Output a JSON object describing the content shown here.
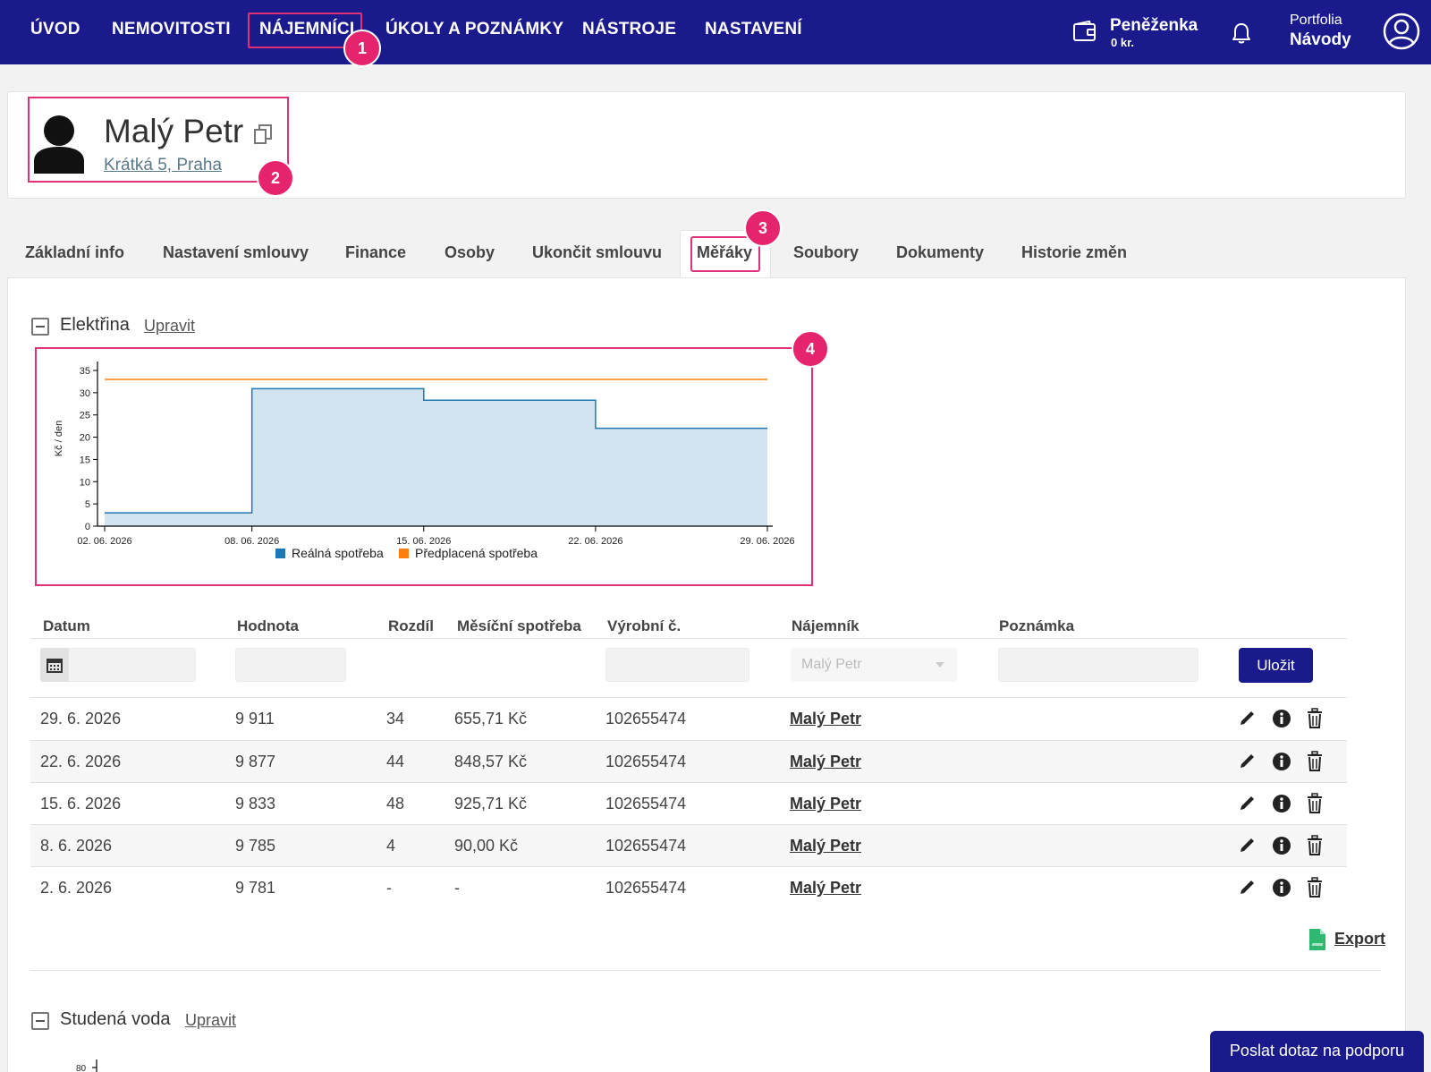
{
  "nav": {
    "items": [
      "ÚVOD",
      "NEMOVITOSTI",
      "NÁJEMNÍCI",
      "ÚKOLY A POZNÁMKY",
      "NÁSTROJE",
      "NASTAVENÍ"
    ],
    "wallet_title": "Peněženka",
    "wallet_value": "0 kr.",
    "portfolio_label": "Portfolia",
    "portfolio_value": "Návody"
  },
  "badges": [
    "1",
    "2",
    "3",
    "4"
  ],
  "tenant": {
    "name": "Malý Petr",
    "address": "Krátká 5, Praha"
  },
  "tabs": [
    "Základní info",
    "Nastavení smlouvy",
    "Finance",
    "Osoby",
    "Ukončit smlouvu",
    "Měřáky",
    "Soubory",
    "Dokumenty",
    "Historie změn"
  ],
  "active_tab": "Měřáky",
  "sections": [
    {
      "title": "Elektřina",
      "edit_label": "Upravit"
    },
    {
      "title": "Studená voda",
      "edit_label": "Upravit"
    }
  ],
  "chart_data": {
    "type": "area",
    "ylabel": "Kč / den",
    "ylim": [
      0,
      35
    ],
    "yticks": [
      "0",
      "5",
      "10",
      "15",
      "20",
      "25",
      "30",
      "35"
    ],
    "xticks": [
      "02. 06. 2026",
      "08. 06. 2026",
      "15. 06. 2026",
      "22. 06. 2026",
      "29. 06. 2026"
    ],
    "series": [
      {
        "name": "Reálná spotřeba",
        "color": "#1f77b4",
        "fill": "#d3e3f0",
        "steps": [
          {
            "from": "02. 06. 2026",
            "to": "08. 06. 2026",
            "value": 3.0
          },
          {
            "from": "08. 06. 2026",
            "to": "15. 06. 2026",
            "value": 30.9
          },
          {
            "from": "15. 06. 2026",
            "to": "22. 06. 2026",
            "value": 28.3
          },
          {
            "from": "22. 06. 2026",
            "to": "29. 06. 2026",
            "value": 22.0
          }
        ]
      },
      {
        "name": "Předplacená spotřeba",
        "color": "#ff7f0e",
        "constant": 33.0
      }
    ],
    "legend_placement": "bottom-center",
    "grid": false
  },
  "second_chart_partial_tick": "80",
  "table": {
    "headers": [
      "Datum",
      "Hodnota",
      "Rozdíl",
      "Měsíční spotřeba",
      "Výrobní č.",
      "Nájemník",
      "Poznámka"
    ],
    "tenant_select_value": "Malý Petr",
    "save_label": "Uložit",
    "rows": [
      {
        "date": "29. 6. 2026",
        "value": "9 911",
        "diff": "34",
        "monthly": "655,71 Kč",
        "serial": "102655474",
        "tenant": "Malý Petr",
        "note": ""
      },
      {
        "date": "22. 6. 2026",
        "value": "9 877",
        "diff": "44",
        "monthly": "848,57 Kč",
        "serial": "102655474",
        "tenant": "Malý Petr",
        "note": ""
      },
      {
        "date": "15. 6. 2026",
        "value": "9 833",
        "diff": "48",
        "monthly": "925,71 Kč",
        "serial": "102655474",
        "tenant": "Malý Petr",
        "note": ""
      },
      {
        "date": "8. 6. 2026",
        "value": "9 785",
        "diff": "4",
        "monthly": "90,00 Kč",
        "serial": "102655474",
        "tenant": "Malý Petr",
        "note": ""
      },
      {
        "date": "2. 6. 2026",
        "value": "9 781",
        "diff": "-",
        "monthly": "-",
        "serial": "102655474",
        "tenant": "Malý Petr",
        "note": ""
      }
    ]
  },
  "export_label": "Export",
  "support_label": "Poslat dotaz na podporu",
  "colors": {
    "nav_bg": "#1a1a8c",
    "highlight": "#e0307a",
    "badge": "#e6246e"
  }
}
